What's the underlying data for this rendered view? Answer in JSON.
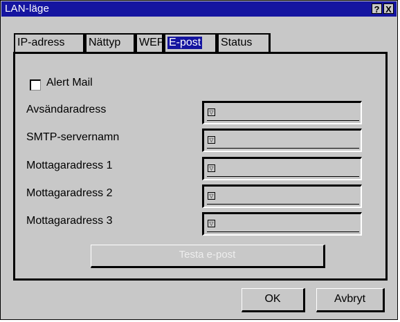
{
  "window": {
    "title": "LAN-läge",
    "help_glyph": "?",
    "close_glyph": "X"
  },
  "tabs": [
    {
      "label": "IP-adress",
      "active": false
    },
    {
      "label": "Nättyp",
      "active": false
    },
    {
      "label": "WEP",
      "active": false
    },
    {
      "label": "E-post",
      "active": true
    },
    {
      "label": "Status",
      "active": false
    }
  ],
  "alert_mail": {
    "label": "Alert Mail",
    "checked": false
  },
  "fields": [
    {
      "label": "Avsändaradress",
      "value": ""
    },
    {
      "label": "SMTP-servernamn",
      "value": ""
    },
    {
      "label": "Mottagaradress 1",
      "value": ""
    },
    {
      "label": "Mottagaradress 2",
      "value": ""
    },
    {
      "label": "Mottagaradress 3",
      "value": ""
    }
  ],
  "test_button": {
    "label": "Testa e-post",
    "enabled": false
  },
  "buttons": {
    "ok": "OK",
    "cancel": "Avbryt"
  },
  "icons": {
    "field_dropdown": "dropdown-arrow-icon"
  },
  "colors": {
    "titlebar": "#1515a0",
    "face": "#c8c8c8",
    "selected_tab": "#1515a0"
  }
}
